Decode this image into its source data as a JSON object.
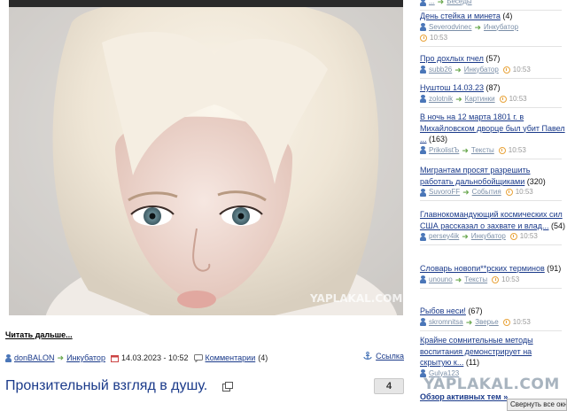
{
  "post": {
    "photo_watermark": "YAPLAKAL.COM",
    "read_more": "Читать дальше...",
    "author": "donBALON",
    "section": "Инкубатор",
    "date": "14.03.2023 - 10:52",
    "comments_label": "Комментарии",
    "comments_count": "(4)",
    "share_label": "Ссылка"
  },
  "next_post": {
    "title": "Пронзительный взгляд в душу.",
    "comment_count": "4"
  },
  "sidebar": {
    "top_partial": {
      "author": "...",
      "section": "Беседы",
      "time": ""
    },
    "items": [
      {
        "title": "День стейка и минета",
        "count": "(4)",
        "author": "Severodvinec",
        "section": "Инкубатор",
        "time": "10:53"
      },
      {
        "title": "Про дохлых пчел",
        "count": "(57)",
        "author": "subb26",
        "section": "Инкубатор",
        "time": "10:53"
      },
      {
        "title": "Нуштош 14.03.23",
        "count": "(87)",
        "author": "zolotnik",
        "section": "Картинки",
        "time": "10:53"
      },
      {
        "title": "В ночь на 12 марта 1801 г. в Михайловском дворце был убит Павел ...",
        "count": "(163)",
        "author": "PrikolistЪ",
        "section": "Тексты",
        "time": "10:53"
      },
      {
        "title": "Мигрантам просят разрешить работать дальнобойщиками",
        "count": "(320)",
        "author": "SuvoroFF",
        "section": "События",
        "time": "10:53"
      },
      {
        "title": "Главнокомандующий космических сил США рассказал о захвате и влад...",
        "count": "(54)",
        "author": "persey4ik",
        "section": "Инкубатор",
        "time": "10:53"
      },
      {
        "title": "Словарь новопи**рских терминов",
        "count": "(91)",
        "author": "unouno",
        "section": "Тексты",
        "time": "10:53"
      },
      {
        "title": "Рыбов неси!",
        "count": "(67)",
        "author": "skromnitsa",
        "section": "Зверье",
        "time": "10:53"
      },
      {
        "title": "Крайне сомнительные методы воспитания демонстрирует на скрытую к...",
        "count": "(11)",
        "author": "Gulya123",
        "section": "",
        "time": ""
      }
    ],
    "footer_link": "Обзор активных тем »",
    "watermark": "YAPLAKAL.COM",
    "collapse_button": "Свернуть все окна"
  },
  "colors": {
    "link": "#1a3a8a",
    "meta_link": "#7b8fa8",
    "arrow": "#6aa84f",
    "clock": "#e8a33a",
    "user": "#4a76b8"
  }
}
